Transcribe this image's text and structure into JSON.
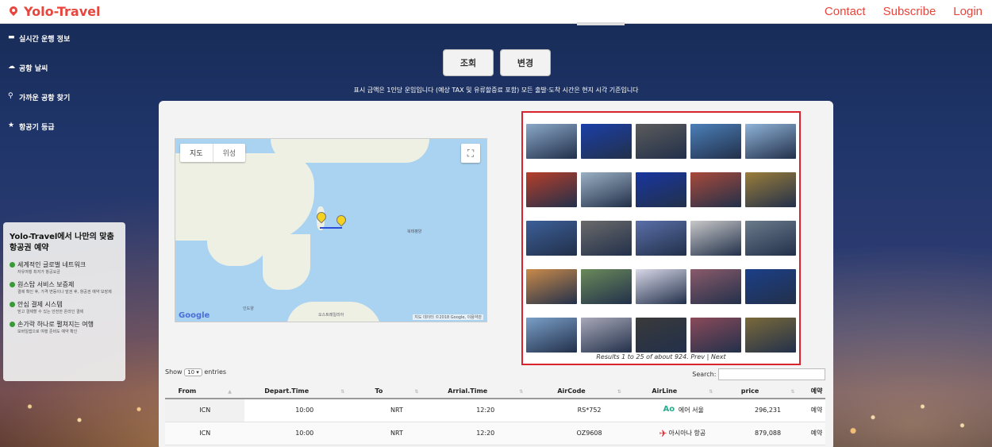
{
  "nav": {
    "brand": "Yolo-Travel",
    "links": [
      "Contact",
      "Subscribe",
      "Login"
    ]
  },
  "side_menu": [
    {
      "icon": "monitor-icon",
      "label": "실시간 운행 정보"
    },
    {
      "icon": "cloud-icon",
      "label": "공항 날씨"
    },
    {
      "icon": "search-icon",
      "label": "가까운 공항 찾기"
    },
    {
      "icon": "star-icon",
      "label": "항공기 등급"
    }
  ],
  "actions": {
    "lookup": "조회",
    "change": "변경"
  },
  "notice": "표시 금액은 1인당 운임입니다 (예상 TAX 및 유류할증료 포함) 모든 출발·도착 시간은 현지 시각 기준입니다",
  "map": {
    "tabs": [
      "지도",
      "위성"
    ],
    "labels": [
      "북태평양",
      "인도양",
      "오스트레일리아"
    ],
    "credit": "지도 데이터 ©2018 Google, 이용약관",
    "google": "Google"
  },
  "photos": {
    "results_text": "Results 1 to 25 of about 924. Prev | Next",
    "colors": [
      "#8aa8c8",
      "#1b3fa8",
      "#5b5b5b",
      "#4b7fb8",
      "#8fb3d8",
      "#b63e2a",
      "#9bb0c4",
      "#1836a0",
      "#a84a3a",
      "#9a7d3a",
      "#3c5f98",
      "#6a6a6a",
      "#5a6fa8",
      "#c8c8c8",
      "#6b7b8b",
      "#c98a4a",
      "#6a8a5a",
      "#d8d8e8",
      "#8a5a6a",
      "#1c3f88",
      "#7a9fc8",
      "#a8a8b8",
      "#3a3a3a",
      "#8a4a5a",
      "#7a6a3a"
    ]
  },
  "table": {
    "show_label": "Show",
    "entries_value": "10",
    "entries_label": "entries",
    "search_label": "Search:",
    "headers": [
      "From",
      "Depart.Time",
      "To",
      "Arrial.Time",
      "AirCode",
      "AirLine",
      "price",
      "예약"
    ],
    "rows": [
      {
        "from": "ICN",
        "depart": "10:00",
        "to": "NRT",
        "arrive": "12:20",
        "code": "RS*752",
        "airline": "에어 서울",
        "price": "296,231",
        "book": "예약"
      },
      {
        "from": "ICN",
        "depart": "10:00",
        "to": "NRT",
        "arrive": "12:20",
        "code": "OZ9608",
        "airline": "아시아나 항공",
        "price": "879,088",
        "book": "예약"
      }
    ]
  },
  "promo": {
    "title": "Yolo-Travel에서 나만의 맞춤 항공권 예약",
    "items": [
      {
        "title": "세계적인 글로벌 네트워크",
        "desc": "자유여행 최저가 항공요금"
      },
      {
        "title": "원스탑 서비스 보증제",
        "desc": "결제 확인 후, 가격 변동이나 발권 후, 항공권 예약 보장제"
      },
      {
        "title": "안심 결제 시스템",
        "desc": "믿고 결제할 수 있는 안전한 온라인 결제"
      },
      {
        "title": "손가락 하나로 펼쳐지는 여행",
        "desc": "모바일앱으로 여행 준비도 예약 확인"
      }
    ]
  }
}
